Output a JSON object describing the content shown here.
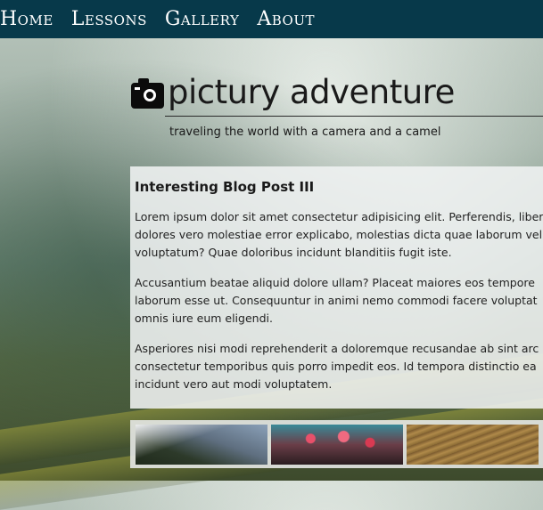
{
  "nav": {
    "items": [
      "Home",
      "Lessons",
      "Gallery",
      "About"
    ]
  },
  "header": {
    "title": "pictury adventure",
    "tagline": "traveling the world with a camera and a camel"
  },
  "post": {
    "title": "Interesting Blog Post III",
    "paragraphs": [
      [
        "Lorem ipsum dolor sit amet consectetur adipisicing elit. Perferendis, liber",
        "dolores vero molestiae error explicabo, molestias dicta quae laborum vel",
        "voluptatum? Quae doloribus incidunt blanditiis fugit iste."
      ],
      [
        "Accusantium beatae aliquid dolore ullam? Placeat maiores eos tempore",
        "laborum esse ut. Consequuntur in animi nemo commodi facere voluptat",
        "omnis iure eum eligendi."
      ],
      [
        "Asperiores nisi modi reprehenderit a doloremque recusandae ab sint arc",
        "consectetur temporibus quis porro impedit eos. Id tempora distinctio ea",
        "incidunt vero aut modi voluptatem."
      ]
    ]
  },
  "gallery": {
    "images": [
      "mountain-photo",
      "lantern-street-photo",
      "rice-terrace-photo"
    ]
  }
}
